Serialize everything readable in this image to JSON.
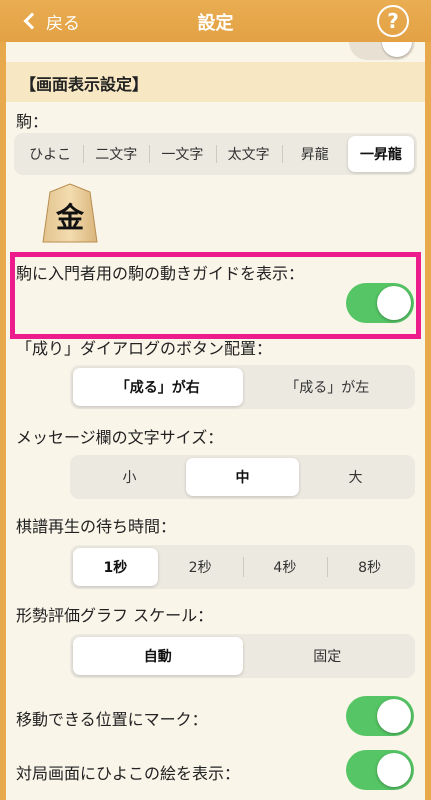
{
  "nav": {
    "back_label": "戻る",
    "title": "設定",
    "help_label": "?"
  },
  "section": {
    "title": "【画面表示設定】"
  },
  "piece": {
    "label": "駒：",
    "options": [
      "ひよこ",
      "二文字",
      "一文字",
      "太文字",
      "昇龍",
      "一昇龍"
    ],
    "selected": "一昇龍",
    "preview_char": "金"
  },
  "guide": {
    "label": "駒に入門者用の駒の動きガイドを表示：",
    "on": true
  },
  "promote_button": {
    "label": "「成り」ダイアログのボタン配置：",
    "options": [
      "「成る」が右",
      "「成る」が左"
    ],
    "selected": "「成る」が右"
  },
  "message_size": {
    "label": "メッセージ欄の文字サイズ：",
    "options": [
      "小",
      "中",
      "大"
    ],
    "selected": "中"
  },
  "playback_wait": {
    "label": "棋譜再生の待ち時間：",
    "options": [
      "1秒",
      "2秒",
      "4秒",
      "8秒"
    ],
    "selected": "1秒"
  },
  "eval_graph": {
    "label": "形勢評価グラフ スケール：",
    "options": [
      "自動",
      "固定"
    ],
    "selected": "自動"
  },
  "movable_mark": {
    "label": "移動できる位置にマーク：",
    "on": true
  },
  "chick_picture": {
    "label": "対局画面にひよこの絵を表示：",
    "on": true
  },
  "colors": {
    "nav_bar": "#e3a144",
    "panel": "#faf5e9",
    "section_header": "#f7e7c3",
    "toggle_on": "#55c565",
    "highlight": "#ec1c8c"
  }
}
